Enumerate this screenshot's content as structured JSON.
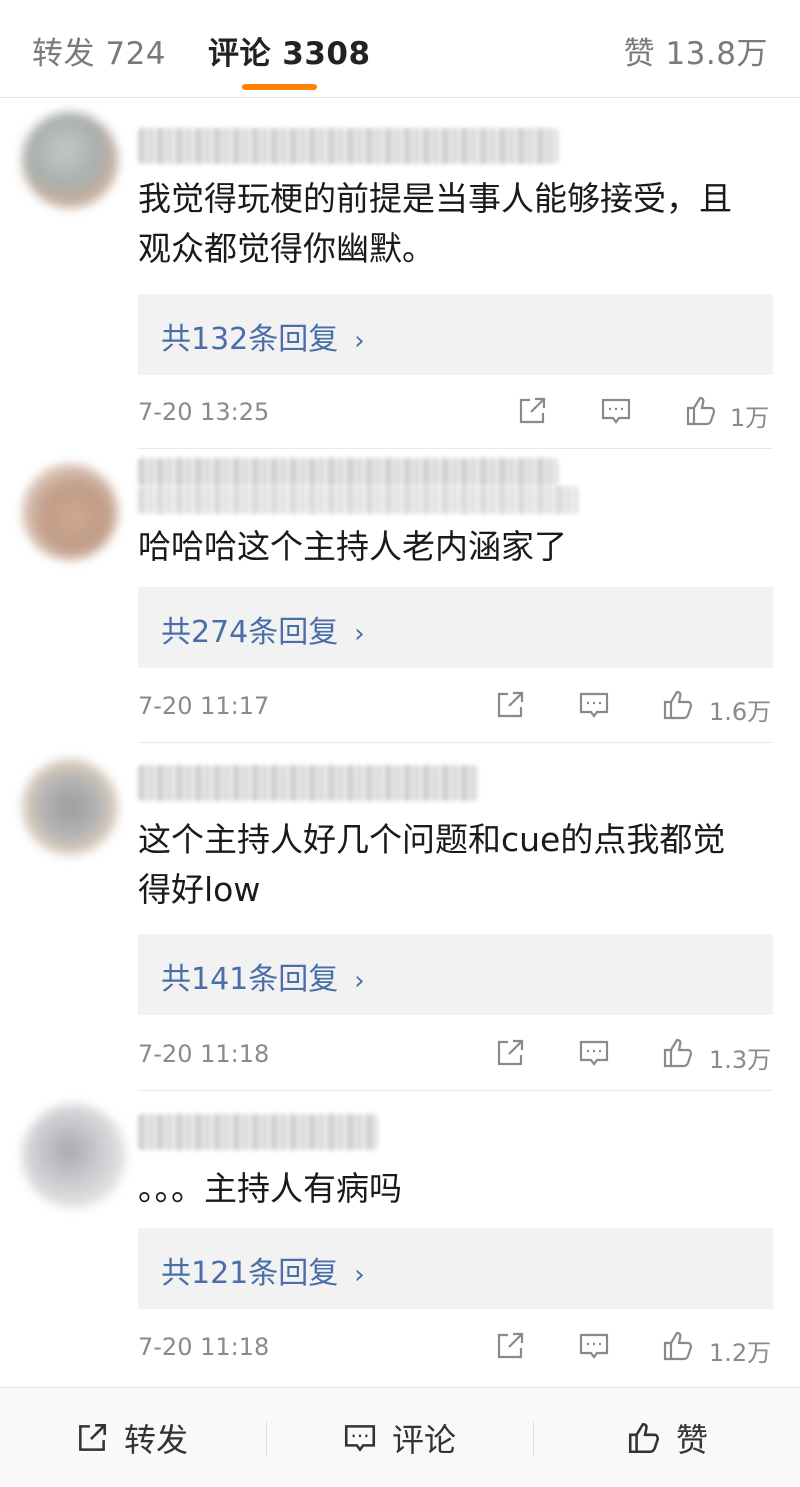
{
  "tabs": {
    "repost": "转发 724",
    "comment": "评论 3308",
    "like": "赞 13.8万"
  },
  "comments": [
    {
      "text": "我觉得玩梗的前提是当事人能够接受，且观众都觉得你幽默。",
      "reply_count": "共132条回复",
      "time": "7-20 13:25",
      "likes": "1万"
    },
    {
      "text": "哈哈哈这个主持人老内涵家了",
      "reply_count": "共274条回复",
      "time": "7-20 11:17",
      "likes": "1.6万"
    },
    {
      "text": "这个主持人好几个问题和cue的点我都觉得好low",
      "reply_count": "共141条回复",
      "time": "7-20 11:18",
      "likes": "1.3万"
    },
    {
      "text": "。。。主持人有病吗",
      "reply_count": "共121条回复",
      "time": "7-20 11:18",
      "likes": "1.2万"
    }
  ],
  "reply_chevron": "›",
  "bottom_bar": {
    "repost": "转发",
    "comment": "评论",
    "like": "赞"
  },
  "colors": {
    "accent": "#ff8200",
    "link": "#4a6fa8",
    "muted": "#8a8a8a"
  },
  "icons": {
    "repost": "share-square-arrow",
    "comment": "speech-bubble",
    "like": "thumbs-up"
  }
}
